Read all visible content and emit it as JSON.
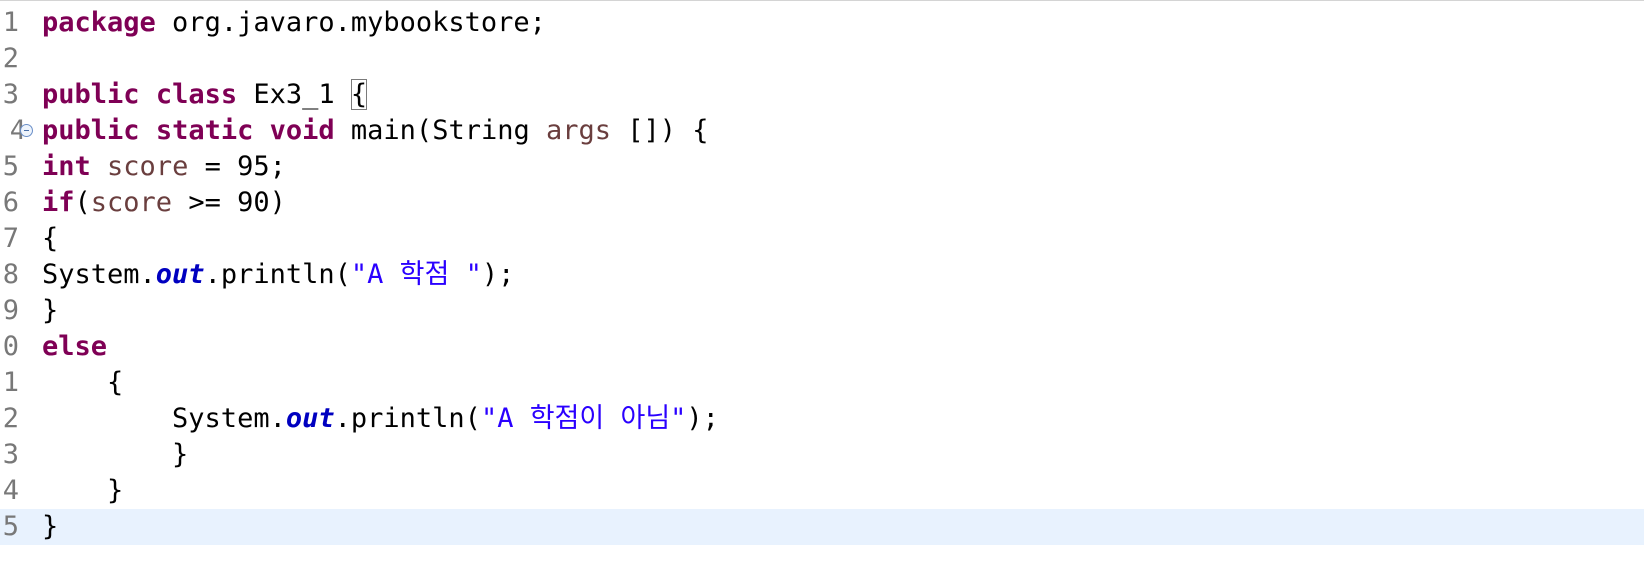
{
  "editor": {
    "lines": [
      {
        "number": "1",
        "kw1": "package",
        "rest": " org.javaro.mybookstore;"
      },
      {
        "number": "2"
      },
      {
        "number": "3",
        "kw1": "public",
        "kw2": "class",
        "name": " Ex3_1 ",
        "brace": "{"
      },
      {
        "number": "4",
        "kw1": "public",
        "kw2": "static",
        "kw3": "void",
        "pre_param": " main(String ",
        "param": "args",
        "post_param": " []) {"
      },
      {
        "number": "5",
        "kw1": "int",
        "var": "score",
        "rest": " = 95;"
      },
      {
        "number": "6",
        "kw1": "if",
        "open": "(",
        "var": "score",
        "rest": " >= 90)"
      },
      {
        "number": "7",
        "text": "{"
      },
      {
        "number": "8",
        "cls": "System.",
        "field": "out",
        "call": ".println(",
        "str": "\"A 학점 \"",
        "end": ");"
      },
      {
        "number": "9",
        "text": "}"
      },
      {
        "number": "0",
        "kw1": "else"
      },
      {
        "number": "1",
        "text": "    {"
      },
      {
        "number": "2",
        "cls": "        System.",
        "field": "out",
        "call": ".println(",
        "str": "\"A 학점이 아님\"",
        "end": ");"
      },
      {
        "number": "3",
        "text": "        }"
      },
      {
        "number": "4",
        "text": "    }"
      },
      {
        "number": "5",
        "text": "}"
      }
    ]
  }
}
